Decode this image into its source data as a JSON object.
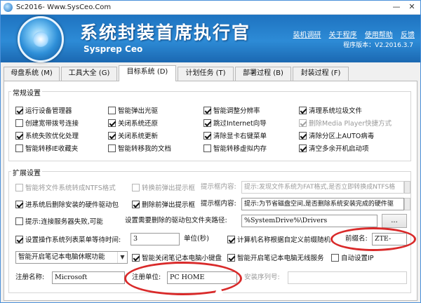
{
  "window": {
    "title": "Sc2016- Www.SysCeo.Com",
    "minimize": "—",
    "close": "✕"
  },
  "header": {
    "title": "系统封装首席执行官",
    "subtitle": "Sysprep Ceo",
    "links": [
      "装机调研",
      "关于程序",
      "使用帮助",
      "反馈"
    ],
    "version": "程序版本：V2.2016.3.7"
  },
  "tabs": [
    {
      "label": "母盘系统 (M)",
      "active": false
    },
    {
      "label": "工具大全 (G)",
      "active": false
    },
    {
      "label": "目标系统 (D)",
      "active": true
    },
    {
      "label": "计划任务 (T)",
      "active": false
    },
    {
      "label": "部署过程 (B)",
      "active": false
    },
    {
      "label": "封装过程 (F)",
      "active": false
    }
  ],
  "general": {
    "title": "常规设置",
    "checkboxes": [
      {
        "label": "运行设备管理器",
        "checked": true,
        "disabled": false
      },
      {
        "label": "智能弹出光驱",
        "checked": false,
        "disabled": false
      },
      {
        "label": "智能调整分辨率",
        "checked": true,
        "disabled": false
      },
      {
        "label": "清理系统垃圾文件",
        "checked": true,
        "disabled": false
      },
      {
        "label": "创建宽带拨号连接",
        "checked": false,
        "disabled": false
      },
      {
        "label": "关闭系统还原",
        "checked": true,
        "disabled": false
      },
      {
        "label": "跳过Internet向导",
        "checked": true,
        "disabled": false
      },
      {
        "label": "删除Media Player快捷方式",
        "checked": true,
        "disabled": true
      },
      {
        "label": "系统失败优化处理",
        "checked": true,
        "disabled": false
      },
      {
        "label": "关闭系统更新",
        "checked": true,
        "disabled": false
      },
      {
        "label": "清除显卡右键菜单",
        "checked": true,
        "disabled": false
      },
      {
        "label": "清除分区上AUTO病毒",
        "checked": true,
        "disabled": false
      },
      {
        "label": "智能转移IE收藏夹",
        "checked": false,
        "disabled": false
      },
      {
        "label": "智能转移我的文档",
        "checked": false,
        "disabled": false
      },
      {
        "label": "智能转移虚拟内存",
        "checked": false,
        "disabled": false
      },
      {
        "label": "清空多余开机启动项",
        "checked": true,
        "disabled": false
      }
    ]
  },
  "extended": {
    "title": "扩展设置",
    "ntfs": {
      "label": "智能将文件系统转成NTFS格式",
      "checked": false
    },
    "convert_prompt": {
      "label": "转换前弹出提示框",
      "checked": false
    },
    "convert_prompt_label": "提示框内容:",
    "convert_prompt_value": "提示:发现文件系统为FAT格式,是否立即转换成NTFS格",
    "reinstall_driver": {
      "label": "进系统后删除安装的硬件驱动包",
      "checked": true
    },
    "delete_prompt": {
      "label": "删除前弹出提示框",
      "checked": true
    },
    "delete_prompt_label": "提示框内容:",
    "delete_prompt_value": "提示:为节省磁盘空间,是否删除系统安装完成的硬件驱",
    "server_fail": {
      "label": "提示:连接服务器失败,可能",
      "checked": false
    },
    "driver_path_label": "设置需要删除的驱动包文件夹路径:",
    "driver_path_value": "%SystemDrive%\\Drivers",
    "browse_label": "...",
    "wait_time": {
      "label": "设置操作系统列表菜单等待时间:",
      "checked": true
    },
    "wait_time_value": "3",
    "wait_unit": "单位(秒)",
    "computer_name": {
      "label": "计算机名称根据自定义前缀随机",
      "checked": true
    },
    "prefix_label": "前缀名:",
    "prefix_value": "ZTE-",
    "sleep_select": "智能开启笔记本电脑休眠功能",
    "laptop_keyboard": {
      "label": "智能关闭笔记本电脑小键盘",
      "checked": true
    },
    "laptop_wireless": {
      "label": "智能开启笔记本电脑无线服务",
      "checked": true
    },
    "auto_ip": {
      "label": "自动设置IP",
      "checked": false
    },
    "owner_label": "注册名称:",
    "owner_value": "Microsoft",
    "org_label": "注册单位:",
    "org_value": "PC HOME",
    "serial_label": "安装序列号:",
    "serial_value": ""
  }
}
